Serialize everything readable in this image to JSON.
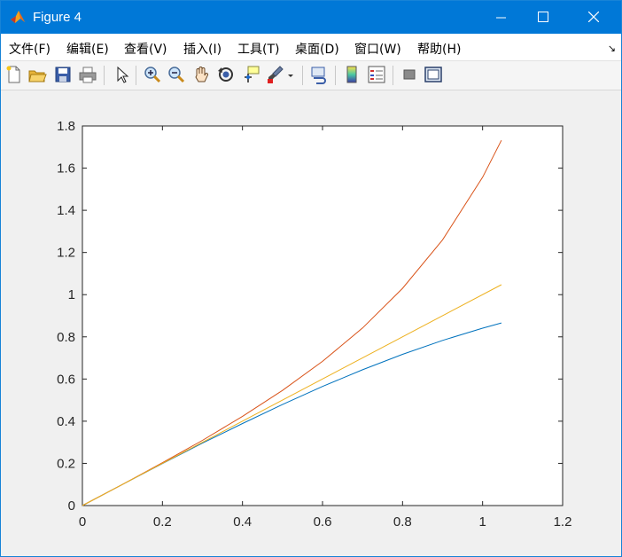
{
  "window": {
    "title": "Figure 4",
    "titlebar_color": "#0078d7"
  },
  "menu": {
    "items": [
      {
        "label": "文件(F)"
      },
      {
        "label": "编辑(E)"
      },
      {
        "label": "查看(V)"
      },
      {
        "label": "插入(I)"
      },
      {
        "label": "工具(T)"
      },
      {
        "label": "桌面(D)"
      },
      {
        "label": "窗口(W)"
      },
      {
        "label": "帮助(H)"
      }
    ]
  },
  "toolbar": {
    "icons": [
      "new-figure-icon",
      "open-file-icon",
      "save-icon",
      "print-icon",
      "select-arrow-icon",
      "zoom-in-icon",
      "zoom-out-icon",
      "pan-hand-icon",
      "rotate-3d-icon",
      "data-cursor-icon",
      "brush-icon",
      "link-plot-icon",
      "colorbar-icon",
      "legend-icon",
      "hide-plot-tools-icon",
      "show-plot-tools-icon"
    ]
  },
  "chart_data": {
    "type": "line",
    "title": "",
    "xlabel": "",
    "ylabel": "",
    "xlim": [
      0,
      1.2
    ],
    "ylim": [
      0,
      1.8
    ],
    "xticks": [
      "0",
      "0.2",
      "0.4",
      "0.6",
      "0.8",
      "1",
      "1.2"
    ],
    "yticks": [
      "0",
      "0.2",
      "0.4",
      "0.6",
      "0.8",
      "1",
      "1.2",
      "1.4",
      "1.6",
      "1.8"
    ],
    "grid": false,
    "series": [
      {
        "color": "#0072bd",
        "x": [
          0,
          0.1,
          0.2,
          0.3,
          0.4,
          0.5,
          0.6,
          0.7,
          0.8,
          0.9,
          1.0,
          1.047
        ],
        "y": [
          0,
          0.1,
          0.199,
          0.296,
          0.389,
          0.479,
          0.565,
          0.644,
          0.717,
          0.783,
          0.841,
          0.866
        ]
      },
      {
        "color": "#d95319",
        "x": [
          0,
          0.1,
          0.2,
          0.3,
          0.4,
          0.5,
          0.6,
          0.7,
          0.8,
          0.9,
          1.0,
          1.047
        ],
        "y": [
          0,
          0.1,
          0.203,
          0.309,
          0.423,
          0.546,
          0.684,
          0.842,
          1.03,
          1.26,
          1.557,
          1.732
        ]
      },
      {
        "color": "#edb120",
        "x": [
          0,
          1.047
        ],
        "y": [
          0,
          1.047
        ]
      }
    ]
  }
}
